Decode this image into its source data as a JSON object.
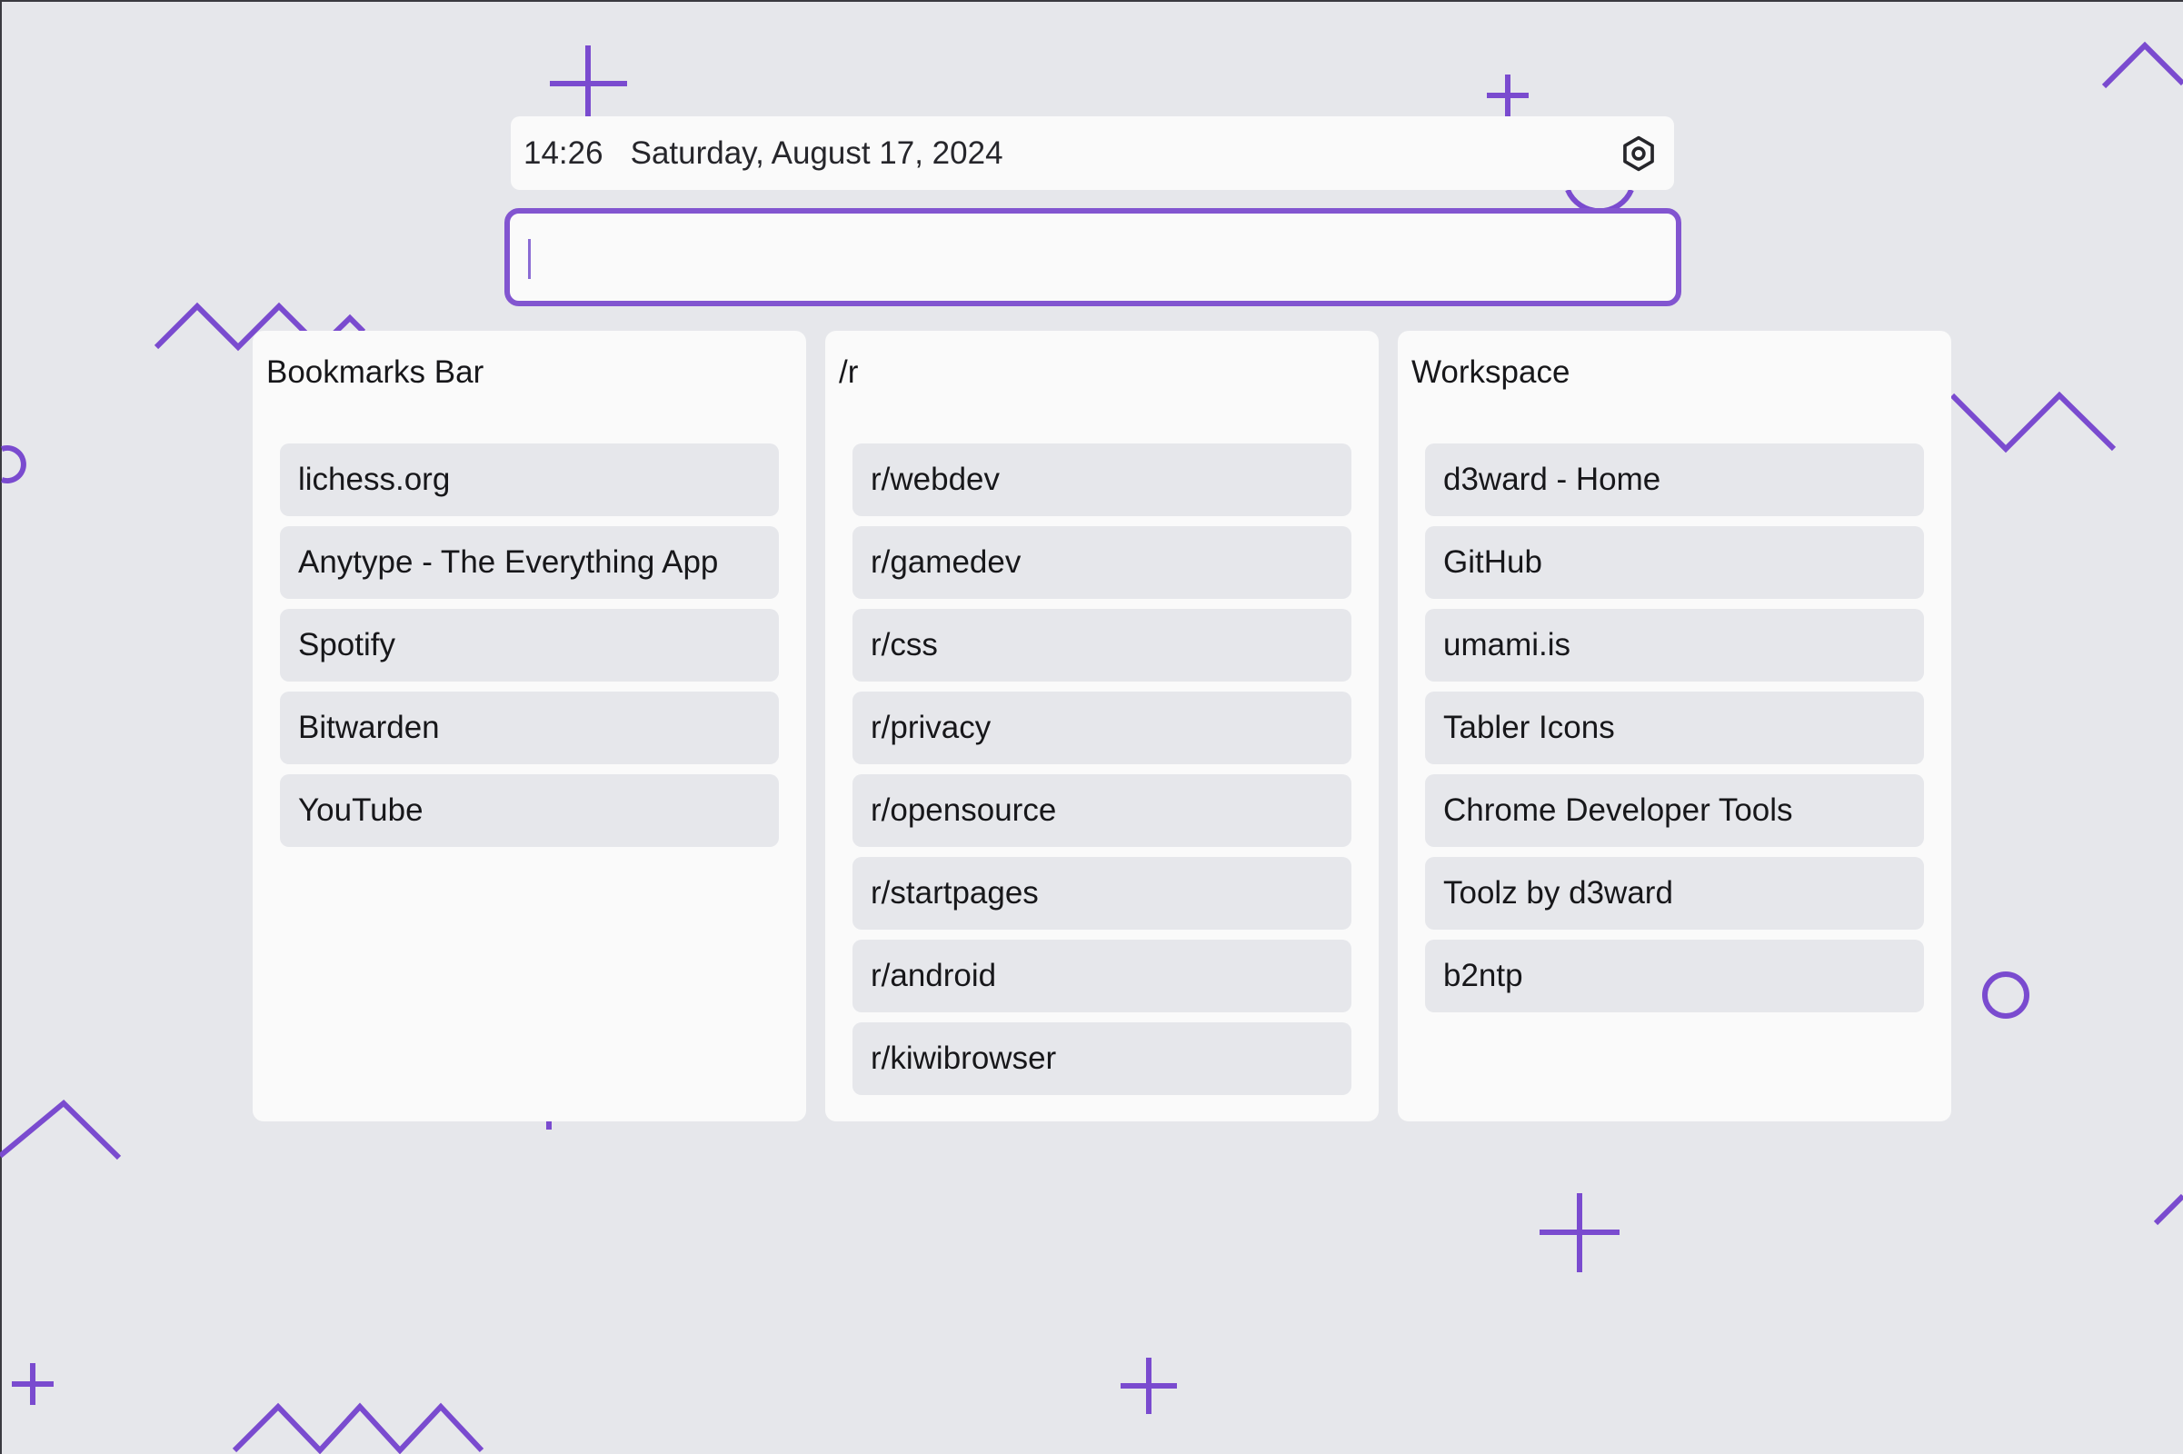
{
  "header": {
    "time": "14:26",
    "date": "Saturday, August 17, 2024",
    "settings_icon": "settings-hexagon-icon"
  },
  "search": {
    "value": "",
    "placeholder": ""
  },
  "columns": [
    {
      "title": "Bookmarks Bar",
      "items": [
        {
          "label": "lichess.org"
        },
        {
          "label": "Anytype - The Everything App"
        },
        {
          "label": "Spotify"
        },
        {
          "label": "Bitwarden"
        },
        {
          "label": "YouTube"
        }
      ]
    },
    {
      "title": "/r",
      "items": [
        {
          "label": "r/webdev"
        },
        {
          "label": "r/gamedev"
        },
        {
          "label": "r/css"
        },
        {
          "label": "r/privacy"
        },
        {
          "label": "r/opensource"
        },
        {
          "label": "r/startpages"
        },
        {
          "label": "r/android"
        },
        {
          "label": "r/kiwibrowser"
        }
      ]
    },
    {
      "title": "Workspace",
      "items": [
        {
          "label": "d3ward - Home"
        },
        {
          "label": "GitHub"
        },
        {
          "label": "umami.is"
        },
        {
          "label": "Tabler Icons"
        },
        {
          "label": "Chrome Developer Tools"
        },
        {
          "label": "Toolz by d3ward"
        },
        {
          "label": "b2ntp"
        }
      ]
    }
  ],
  "theme": {
    "accent": "#8255d0",
    "background": "#e6e7eb",
    "card": "#fafafa",
    "item": "#e6e7eb"
  }
}
